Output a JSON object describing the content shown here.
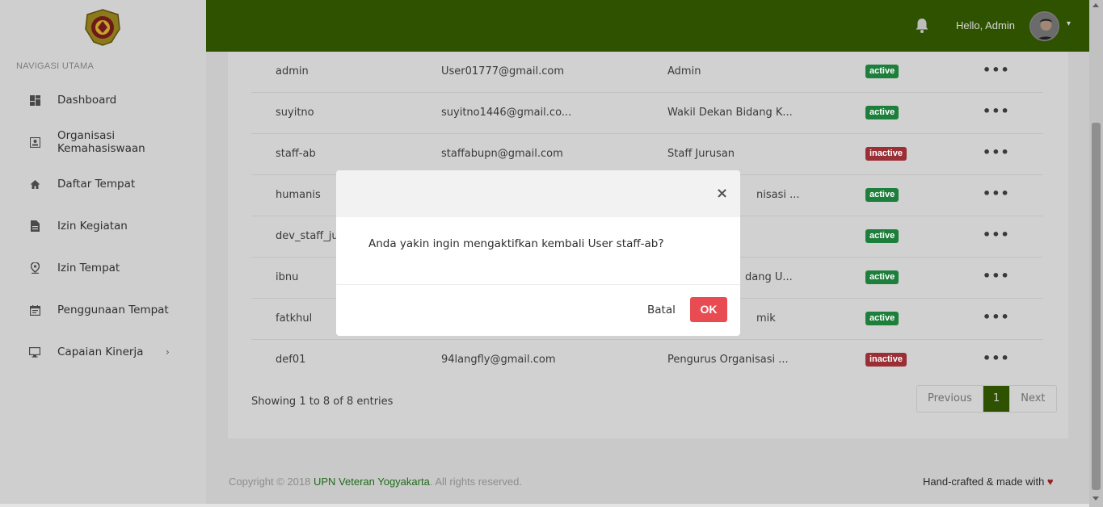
{
  "sidebar": {
    "heading": "NAVIGASI UTAMA",
    "items": [
      {
        "label": "Dashboard",
        "icon": "dashboard-icon"
      },
      {
        "label": "Organisasi Kemahasiswaan",
        "icon": "id-card-icon"
      },
      {
        "label": "Daftar Tempat",
        "icon": "home-icon"
      },
      {
        "label": "Izin Kegiatan",
        "icon": "document-icon"
      },
      {
        "label": "Izin Tempat",
        "icon": "map-pin-icon"
      },
      {
        "label": "Penggunaan Tempat",
        "icon": "calendar-icon"
      },
      {
        "label": "Capaian Kinerja",
        "icon": "monitor-icon"
      }
    ]
  },
  "header": {
    "greeting": "Hello, Admin",
    "bg_color": "#4a7f00"
  },
  "table": {
    "rows": [
      {
        "username": "admin",
        "email": "User01777@gmail.com",
        "role": "Admin",
        "status": "active"
      },
      {
        "username": "suyitno",
        "email": "suyitno1446@gmail.co...",
        "role": "Wakil Dekan Bidang K...",
        "status": "active"
      },
      {
        "username": "staff-ab",
        "email": "staffabupn@gmail.com",
        "role": "Staff Jurusan",
        "status": "inactive"
      },
      {
        "username": "humanis",
        "email": "",
        "role": "nisasi ...",
        "status": "active"
      },
      {
        "username": "dev_staff_jur",
        "email": "",
        "role": "",
        "status": "active"
      },
      {
        "username": "ibnu",
        "email": "",
        "role": "dang U...",
        "status": "active"
      },
      {
        "username": "fatkhul",
        "email": "",
        "role": "mik",
        "status": "active"
      },
      {
        "username": "def01",
        "email": "94langfly@gmail.com",
        "role": "Pengurus Organisasi ...",
        "status": "inactive"
      }
    ],
    "entries_info": "Showing 1 to 8 of 8 entries",
    "pagination": {
      "previous": "Previous",
      "current": "1",
      "next": "Next"
    },
    "more_glyph": "•••"
  },
  "footer": {
    "copyright_prefix": "Copyright © 2018 ",
    "copyright_link": "UPN Veteran Yogyakarta",
    "copyright_suffix": ". All rights reserved.",
    "made_with": "Hand-crafted & made with",
    "heart": "♥"
  },
  "modal": {
    "close": "×",
    "message": "Anda yakin ingin mengaktifkan kembali User staff-ab?",
    "cancel_label": "Batal",
    "ok_label": "OK"
  },
  "colors": {
    "active": "#27a74a",
    "inactive": "#cc3a42",
    "ok_button": "#e84b52",
    "brand_green": "#4a7f00"
  }
}
